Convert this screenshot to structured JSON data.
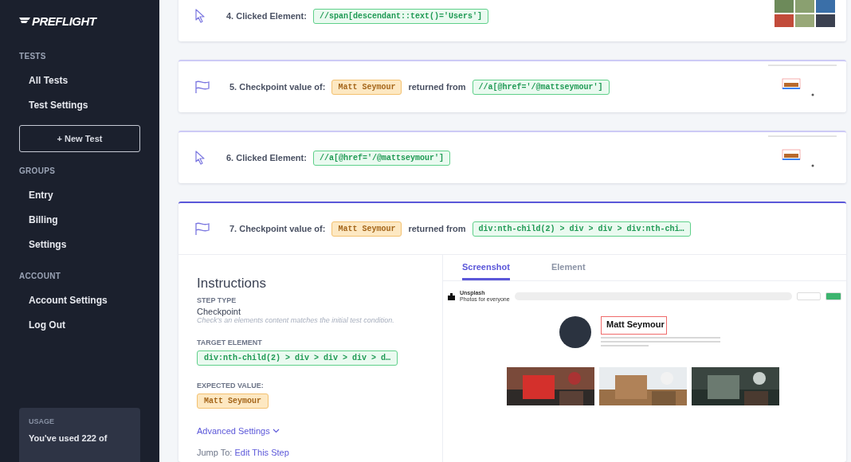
{
  "sidebar": {
    "logo": "PREFLIGHT",
    "sections": [
      {
        "title": "TESTS",
        "items": [
          {
            "label": "All Tests"
          },
          {
            "label": "Test Settings"
          }
        ],
        "button": "+ New Test"
      },
      {
        "title": "GROUPS",
        "items": [
          {
            "label": "Entry"
          },
          {
            "label": "Billing"
          },
          {
            "label": "Settings"
          }
        ]
      },
      {
        "title": "ACCOUNT",
        "items": [
          {
            "label": "Account Settings"
          },
          {
            "label": "Log Out"
          }
        ]
      }
    ],
    "usage": {
      "title": "USAGE",
      "text": "You've used **222** of"
    }
  },
  "steps": [
    {
      "kind": "click",
      "label": "4. Clicked Element:",
      "selector": "//span[descendant::text()='Users']",
      "thumbnail": {
        "kind": "grid"
      },
      "expanded": false
    },
    {
      "kind": "checkpoint",
      "label": "5. Checkpoint value of:",
      "value": "Matt Seymour",
      "connector": "returned from",
      "selector": "//a[@href='/@mattseymour']",
      "thumbnail": {
        "kind": "profile"
      },
      "expanded": false
    },
    {
      "kind": "click",
      "label": "6. Clicked Element:",
      "selector": "//a[@href='/@mattseymour']",
      "thumbnail": {
        "kind": "profile"
      },
      "expanded": false
    },
    {
      "kind": "checkpoint",
      "label": "7. Checkpoint value of:",
      "value": "Matt Seymour",
      "connector": "returned from",
      "selector": "div:nth-child(2) > div > div > div:nth-chi…",
      "expanded": true
    }
  ],
  "detail": {
    "title": "Instructions",
    "step_type": {
      "label": "STEP TYPE",
      "value": "Checkpoint",
      "hint": "Check's an elements content matches the initial test condition."
    },
    "target": {
      "label": "TARGET ELEMENT",
      "value": "div:nth-child(2) > div > div > div > d…"
    },
    "expected": {
      "label": "EXPECTED VALUE:",
      "value": "Matt Seymour"
    },
    "advanced": "Advanced Settings",
    "jump": {
      "label": "Jump To:",
      "link": "Edit This Step"
    },
    "tabs": [
      {
        "label": "Screenshot",
        "selected": true
      },
      {
        "label": "Element",
        "selected": false
      }
    ],
    "screenshot": {
      "brand": "Unsplash",
      "tagline": "Photos for everyone",
      "name": "Matt Seymour"
    }
  }
}
